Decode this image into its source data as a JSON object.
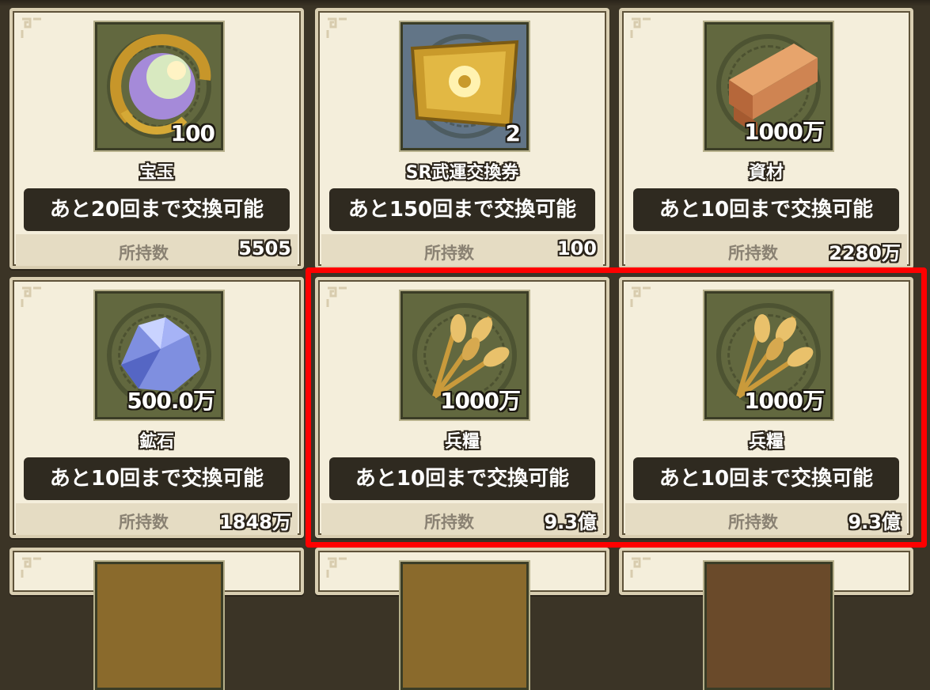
{
  "owned_label": "所持数",
  "items": [
    {
      "name": "宝玉",
      "quantity": "100",
      "limit": "あと20回まで交換可能",
      "owned": "5505",
      "icon": "jade-orb-icon"
    },
    {
      "name": "SR武運交換券",
      "quantity": "2",
      "limit": "あと150回まで交換可能",
      "owned": "100",
      "icon": "exchange-ticket-icon"
    },
    {
      "name": "資材",
      "quantity": "1000万",
      "limit": "あと10回まで交換可能",
      "owned": "2280万",
      "icon": "lumber-icon"
    },
    {
      "name": "鉱石",
      "quantity": "500.0万",
      "limit": "あと10回まで交換可能",
      "owned": "1848万",
      "icon": "ore-crystal-icon"
    },
    {
      "name": "兵糧",
      "quantity": "1000万",
      "limit": "あと10回まで交換可能",
      "owned": "9.3億",
      "icon": "wheat-icon"
    },
    {
      "name": "兵糧",
      "quantity": "1000万",
      "limit": "あと10回まで交換可能",
      "owned": "9.3億",
      "icon": "wheat-icon"
    }
  ],
  "colors": {
    "highlight": "#ff0000",
    "card_bg": "#f4eedb",
    "limit_bg": "#2f2a20"
  }
}
